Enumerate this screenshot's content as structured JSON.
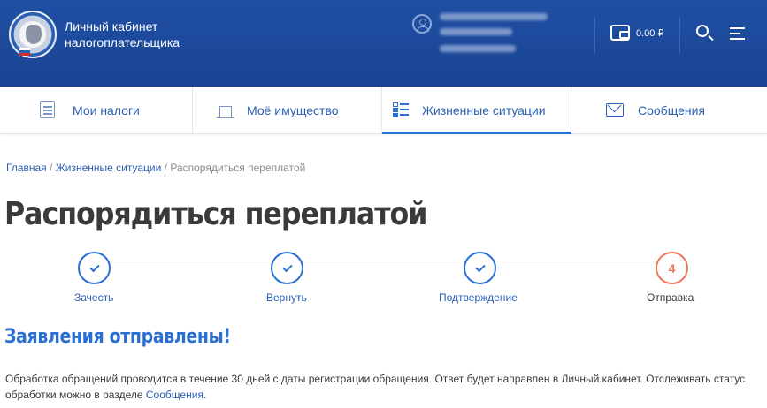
{
  "header": {
    "brand_line1": "Личный кабинет",
    "brand_line2": "налогоплательщика",
    "balance": "0.00 ₽"
  },
  "tabs": [
    {
      "label": "Мои налоги",
      "icon": "document-icon"
    },
    {
      "label": "Моё имущество",
      "icon": "house-icon"
    },
    {
      "label": "Жизненные ситуации",
      "icon": "list-icon",
      "active": true
    },
    {
      "label": "Сообщения",
      "icon": "mail-icon"
    }
  ],
  "breadcrumb": {
    "home": "Главная",
    "sep1": " / ",
    "section": "Жизненные ситуации",
    "sep2": " / ",
    "current": "Распорядиться переплатой"
  },
  "page_title": "Распорядиться переплатой",
  "steps": [
    {
      "label": "Зачесть",
      "state": "done"
    },
    {
      "label": "Вернуть",
      "state": "done"
    },
    {
      "label": "Подтверждение",
      "state": "done"
    },
    {
      "label": "Отправка",
      "state": "current",
      "number": "4"
    }
  ],
  "success_title": "Заявления отправлены!",
  "info": {
    "text": "Обработка обращений проводится в течение 30 дней с даты регистрации обращения. Ответ будет направлен в  Личный кабинет. Отслеживать статус обработки можно в разделе ",
    "link": "Сообщения",
    "end": "."
  },
  "colors": {
    "header_bg": "#1f4fa3",
    "accent": "#2a6fd4",
    "current_step": "#f0775a"
  }
}
